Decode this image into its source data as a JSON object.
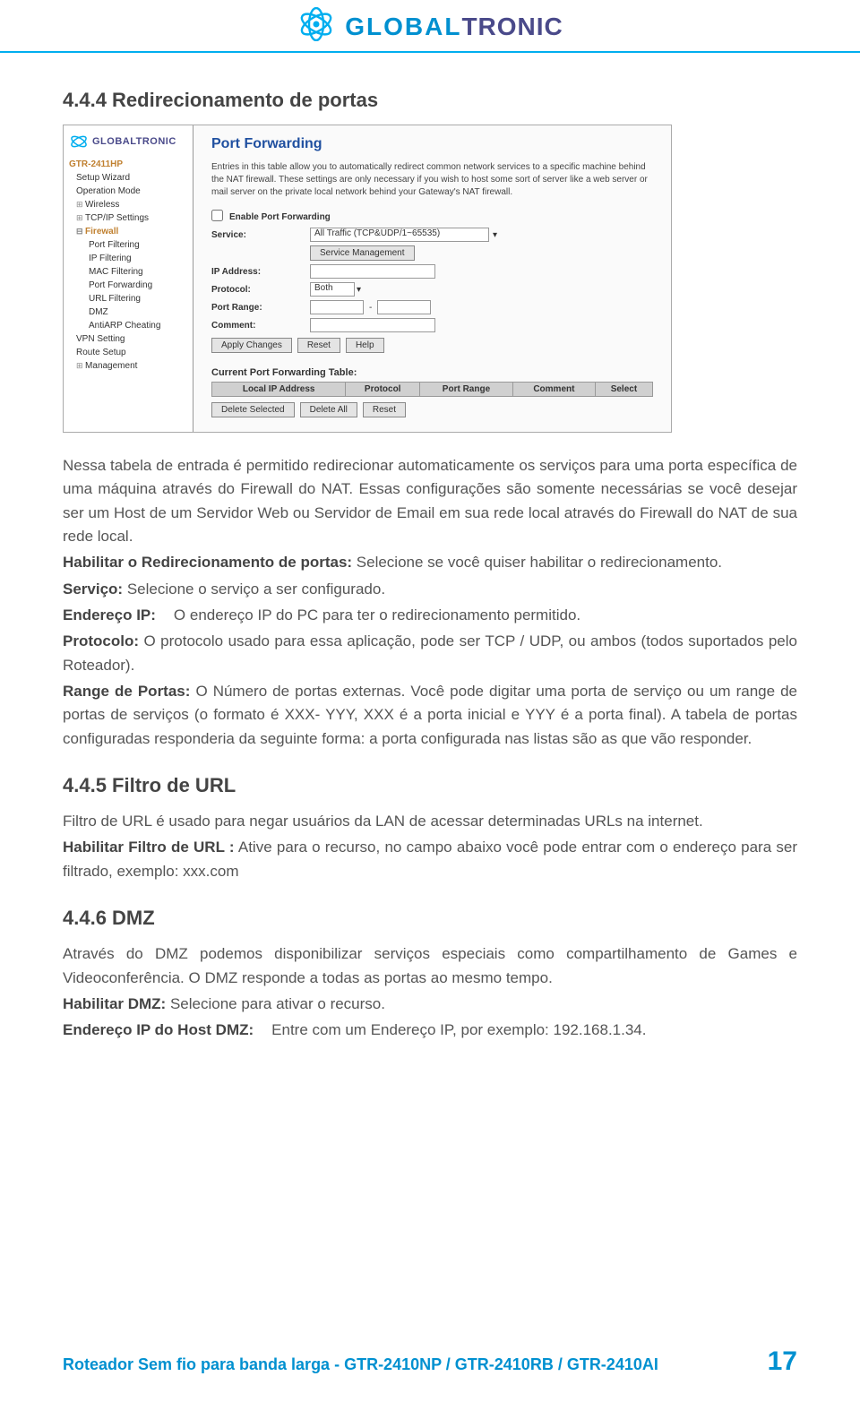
{
  "brand": {
    "name_part1": "GLOBAL",
    "name_part2": "TRONIC"
  },
  "section_444": {
    "title": "4.4.4 Redirecionamento de portas"
  },
  "screenshot": {
    "nav": {
      "model": "GTR-2411HP",
      "items": [
        "Setup Wizard",
        "Operation Mode",
        "Wireless",
        "TCP/IP Settings",
        "Firewall",
        "Port Filtering",
        "IP Filtering",
        "MAC Filtering",
        "Port Forwarding",
        "URL Filtering",
        "DMZ",
        "AntiARP Cheating",
        "VPN Setting",
        "Route Setup",
        "Management"
      ]
    },
    "panel": {
      "title": "Port Forwarding",
      "desc": "Entries in this table allow you to automatically redirect common network services to a specific machine behind the NAT firewall. These settings are only necessary if you wish to host some sort of server like a web server or mail server on the private local network behind your Gateway's NAT firewall.",
      "enable_label": "Enable Port Forwarding",
      "rows": {
        "service": "Service:",
        "service_value": "All Traffic (TCP&UDP/1~65535)",
        "service_btn": "Service Management",
        "ip": "IP Address:",
        "protocol": "Protocol:",
        "protocol_value": "Both",
        "range": "Port Range:",
        "comment": "Comment:"
      },
      "buttons": {
        "apply": "Apply Changes",
        "reset": "Reset",
        "help": "Help"
      },
      "table_title": "Current Port Forwarding Table:",
      "table_headers": [
        "Local IP Address",
        "Protocol",
        "Port Range",
        "Comment",
        "Select"
      ],
      "table_buttons": {
        "del_sel": "Delete Selected",
        "del_all": "Delete All",
        "reset": "Reset"
      }
    }
  },
  "body": {
    "p1": "Nessa tabela de entrada é permitido redirecionar automaticamente os serviços para uma porta específica de uma máquina através do Firewall do NAT. Essas configurações são somente necessárias se você desejar ser um Host de um Servidor Web ou Servidor de Email em sua rede local através do Firewall do NAT de sua rede local.",
    "p2_b": "Habilitar o Redirecionamento de portas:",
    "p2": " Selecione se você quiser habilitar o redirecionamento.",
    "p3_b": "Serviço:",
    "p3": " Selecione o serviço a ser configurado.",
    "p4_b": "Endereço IP:",
    "p4": "O endereço IP do PC para ter o redirecionamento permitido.",
    "p5_b": "Protocolo:",
    "p5": " O protocolo usado para essa aplicação, pode ser TCP / UDP, ou ambos (todos suportados pelo Roteador).",
    "p6_b": "Range de Portas:",
    "p6": " O Número de portas externas. Você pode digitar uma porta de serviço ou um range de portas de serviços (o formato é XXX- YYY,  XXX é a porta inicial e YYY é a porta final). A tabela de portas configuradas responderia da seguinte forma: a porta configurada nas listas são as que vão responder."
  },
  "section_445": {
    "title": "4.4.5 Filtro de URL",
    "p1": "Filtro de URL é usado para negar usuários da LAN de acessar determinadas URLs na internet.",
    "p2_b": "Habilitar Filtro de URL :",
    "p2": " Ative para o recurso, no campo abaixo você pode entrar com o endereço para ser filtrado, exemplo: xxx.com"
  },
  "section_446": {
    "title": "4.4.6   DMZ",
    "p1": "Através do DMZ podemos disponibilizar serviços especiais como compartilhamento de Games e Videoconferência. O DMZ responde a todas as portas ao mesmo tempo.",
    "p2_b": "Habilitar DMZ:",
    "p2": " Selecione para ativar o recurso.",
    "p3_b": "Endereço IP do Host DMZ:",
    "p3": "Entre com um Endereço IP, por exemplo: 192.168.1.34."
  },
  "footer": {
    "left": "Roteador Sem fio para banda larga - GTR-2410NP / GTR-2410RB / GTR-2410AI",
    "page": "17"
  }
}
